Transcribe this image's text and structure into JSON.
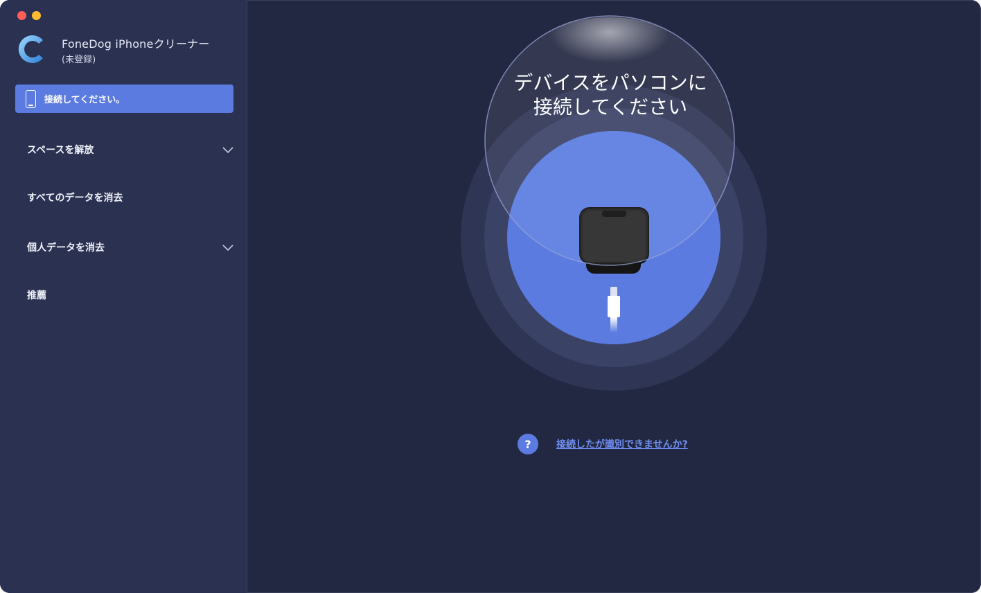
{
  "window": {
    "controls": [
      "close",
      "minimize"
    ]
  },
  "app": {
    "title": "FoneDog iPhoneクリーナー",
    "subtitle": "(未登録)",
    "logo_icon": "fonedog-c-logo-icon"
  },
  "sidebar": {
    "connect_button": {
      "label": "接続してください。",
      "icon": "phone-icon"
    },
    "items": [
      {
        "label": "スペースを解放",
        "expandable": true
      },
      {
        "label": "すべてのデータを消去",
        "expandable": false
      },
      {
        "label": "個人データを消去",
        "expandable": true
      },
      {
        "label": "推薦",
        "expandable": false
      }
    ]
  },
  "main": {
    "heading_line1": "デバイスをパソコンに",
    "heading_line2": "接続してください",
    "help_icon_text": "?",
    "help_link": "接続したが識別できませんか?"
  },
  "colors": {
    "accent": "#5b7be0",
    "sidebar_bg": "#2b3150",
    "main_bg": "#232842",
    "link": "#6f8ef0"
  }
}
